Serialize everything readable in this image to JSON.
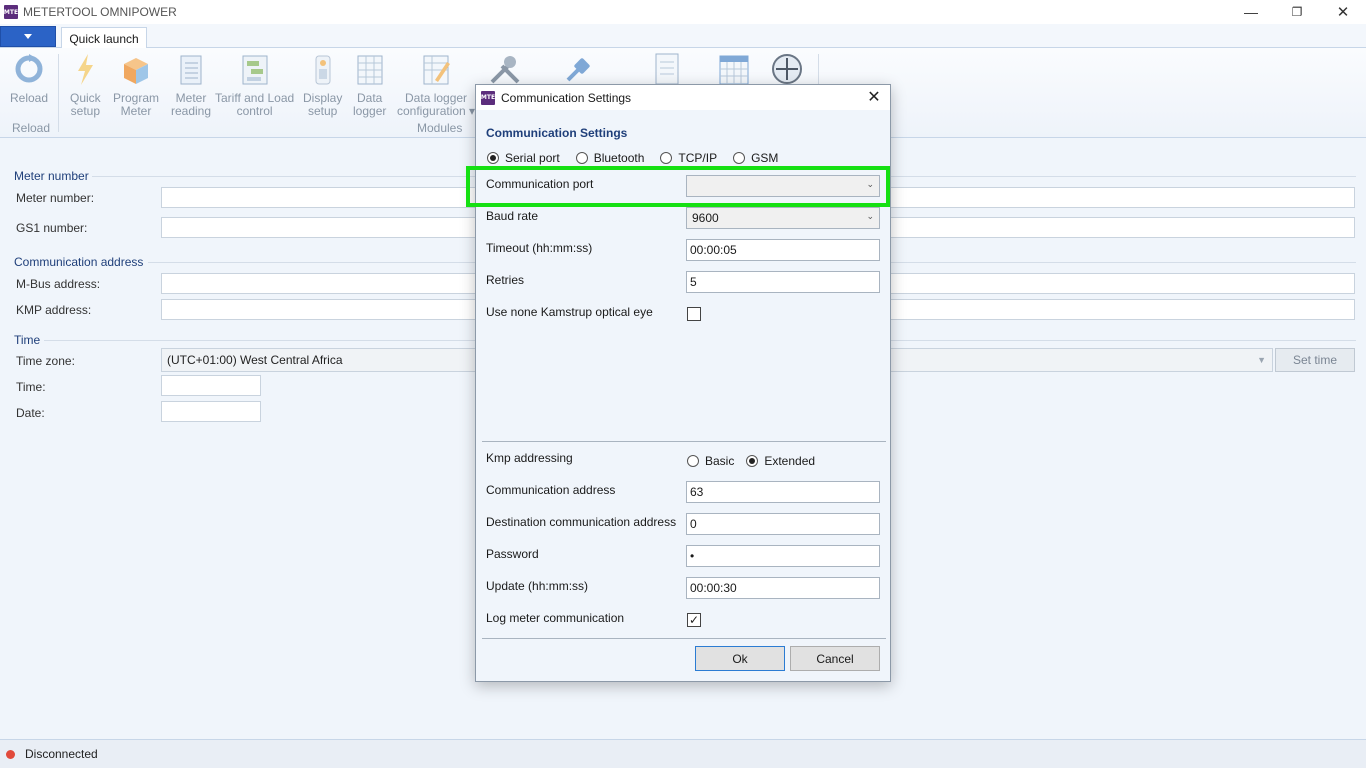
{
  "app": {
    "title": "METERTOOL OMNIPOWER",
    "logo_text": "MTE"
  },
  "window_controls": {
    "minimize": "—",
    "restore": "❐",
    "close": "✕"
  },
  "ribbon": {
    "tab": "Quick launch",
    "groups": [
      {
        "label": "Reload"
      },
      {
        "label": "Modules"
      }
    ],
    "items": [
      {
        "label1": "Reload",
        "label2": "",
        "icon": "reload-icon"
      },
      {
        "label1": "Quick",
        "label2": "setup",
        "icon": "lightning-icon"
      },
      {
        "label1": "Program",
        "label2": "Meter",
        "icon": "box-icon"
      },
      {
        "label1": "Meter",
        "label2": "reading",
        "icon": "notebook-icon"
      },
      {
        "label1": "Tariff and Load",
        "label2": "control",
        "icon": "tariff-icon"
      },
      {
        "label1": "Display",
        "label2": "setup",
        "icon": "display-icon"
      },
      {
        "label1": "Data",
        "label2": "logger",
        "icon": "grid-icon"
      },
      {
        "label1": "Data logger",
        "label2": "configuration ▾",
        "icon": "config-icon"
      }
    ]
  },
  "main": {
    "meter_number_section": "Meter number",
    "meter_number_label": "Meter number:",
    "gs1_label": "GS1 number:",
    "comm_section": "Communication address",
    "mbus_label": "M-Bus address:",
    "kmp_label": "KMP address:",
    "time_section": "Time",
    "timezone_label": "Time zone:",
    "timezone_value": "(UTC+01:00) West Central Africa",
    "time_label": "Time:",
    "date_label": "Date:",
    "set_time_button": "Set time"
  },
  "status": {
    "text": "Disconnected",
    "color": "#e14a3b"
  },
  "dialog": {
    "title": "Communication Settings",
    "logo_text": "MTE",
    "heading": "Communication Settings",
    "connection_types": [
      {
        "label": "Serial port",
        "selected": true
      },
      {
        "label": "Bluetooth",
        "selected": false
      },
      {
        "label": "TCP/IP",
        "selected": false
      },
      {
        "label": "GSM",
        "selected": false
      }
    ],
    "comm_port_label": "Communication port",
    "comm_port_value": "",
    "baud_rate_label": "Baud rate",
    "baud_rate_value": "9600",
    "timeout_label": "Timeout (hh:mm:ss)",
    "timeout_value": "00:00:05",
    "retries_label": "Retries",
    "retries_value": "5",
    "optical_eye_label": "Use none Kamstrup optical eye",
    "optical_eye_checked": false,
    "kmp_addressing_label": "Kmp addressing",
    "kmp_addressing_options": [
      {
        "label": "Basic",
        "selected": false
      },
      {
        "label": "Extended",
        "selected": true
      }
    ],
    "comm_address_label": "Communication address",
    "comm_address_value": "63",
    "dest_address_label": "Destination communication address",
    "dest_address_value": "0",
    "password_label": "Password",
    "password_value": "•",
    "update_label": "Update (hh:mm:ss)",
    "update_value": "00:00:30",
    "log_comm_label": "Log meter communication",
    "log_comm_checked": true,
    "ok_button": "Ok",
    "cancel_button": "Cancel"
  },
  "highlight_color": "#15e012"
}
